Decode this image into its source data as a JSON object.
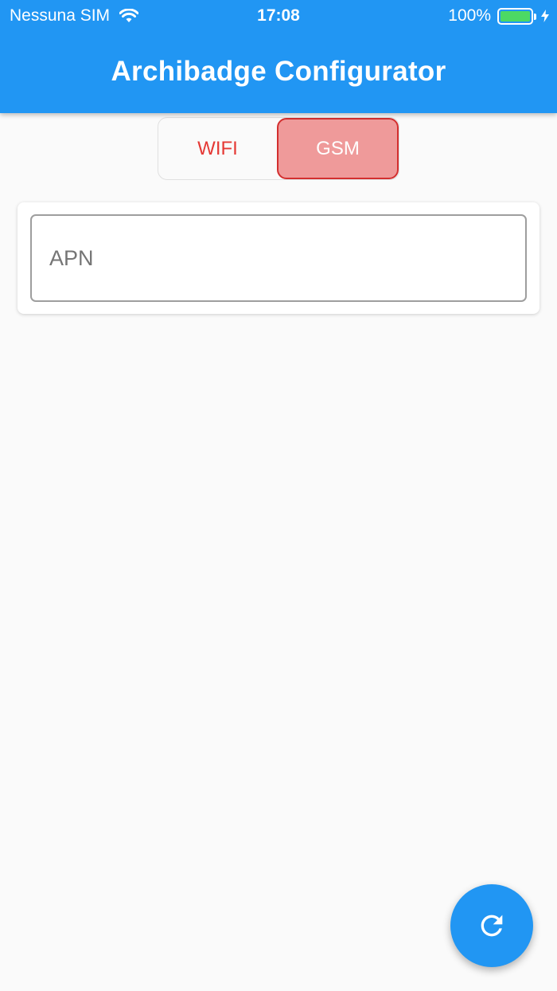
{
  "status_bar": {
    "carrier": "Nessuna SIM",
    "time": "17:08",
    "battery": "100%",
    "battery_color": "#4cd964"
  },
  "app_bar": {
    "title": "Archibadge Configurator",
    "color": "#2196f3"
  },
  "mode_toggle": {
    "options": [
      "WIFI",
      "GSM"
    ],
    "selected": "GSM",
    "accent": "#e53935"
  },
  "form": {
    "apn_placeholder": "APN",
    "apn_value": ""
  },
  "fab": {
    "icon": "refresh-icon"
  }
}
